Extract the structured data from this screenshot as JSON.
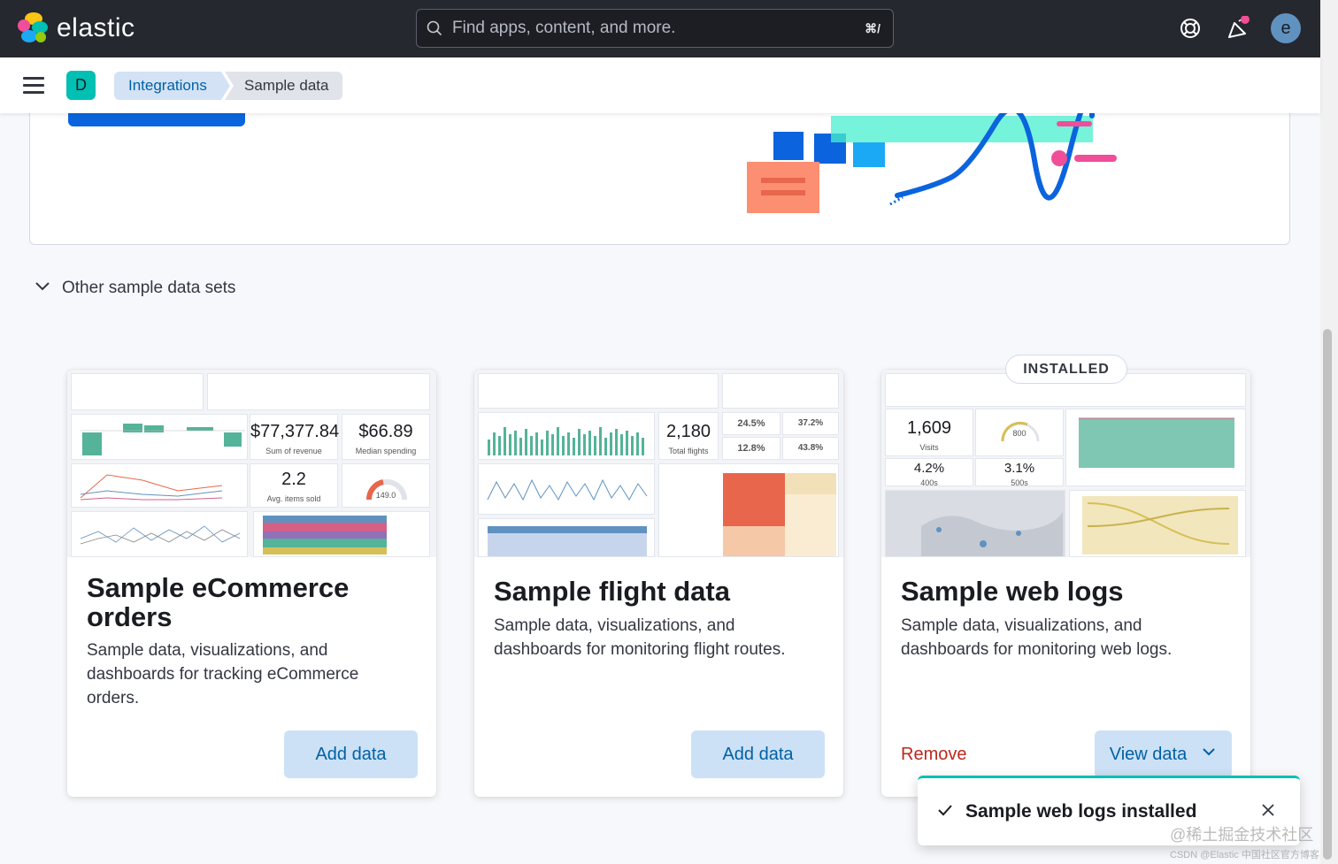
{
  "header": {
    "logo_text": "elastic",
    "search_placeholder": "Find apps, content, and more.",
    "search_shortcut": "⌘/",
    "avatar_initial": "e"
  },
  "breadcrumbs": {
    "space_initial": "D",
    "items": [
      "Integrations",
      "Sample data"
    ]
  },
  "accordion": {
    "label": "Other sample data sets"
  },
  "cards": [
    {
      "title": "Sample eCommerce orders",
      "description": "Sample data, visualizations, and dashboards for tracking eCommerce orders.",
      "button": "Add data",
      "preview": {
        "metric1": "$77,377.84",
        "metric1_label": "Sum of revenue",
        "metric2": "$66.89",
        "metric2_label": "Median spending",
        "metric3": "2.2",
        "metric3_label": "Avg. items sold",
        "gauge": "149.0"
      }
    },
    {
      "title": "Sample flight data",
      "description": "Sample data, visualizations, and dashboards for monitoring flight routes.",
      "button": "Add data",
      "preview": {
        "metric1": "2,180",
        "metric1_label": "Total flights",
        "p1": "24.5%",
        "p2": "37.2%",
        "p3": "12.8%",
        "p4": "43.8%"
      }
    },
    {
      "title": "Sample web logs",
      "description": "Sample data, visualizations, and dashboards for monitoring web logs.",
      "badge": "INSTALLED",
      "remove_label": "Remove",
      "view_label": "View data",
      "preview": {
        "metric1": "1,609",
        "metric1_label": "Visits",
        "gauge": "800",
        "p1": "4.2%",
        "p1_label": "400s",
        "p2": "3.1%",
        "p2_label": "500s"
      }
    }
  ],
  "toast": {
    "title": "Sample web logs installed"
  },
  "watermark": {
    "line1": "@稀土掘金技术社区",
    "line2": "CSDN @Elastic 中国社区官方博客"
  },
  "colors": {
    "accent": "#0b64dd",
    "success": "#00bfb3",
    "danger": "#bd271e",
    "header_bg": "#25282f"
  }
}
